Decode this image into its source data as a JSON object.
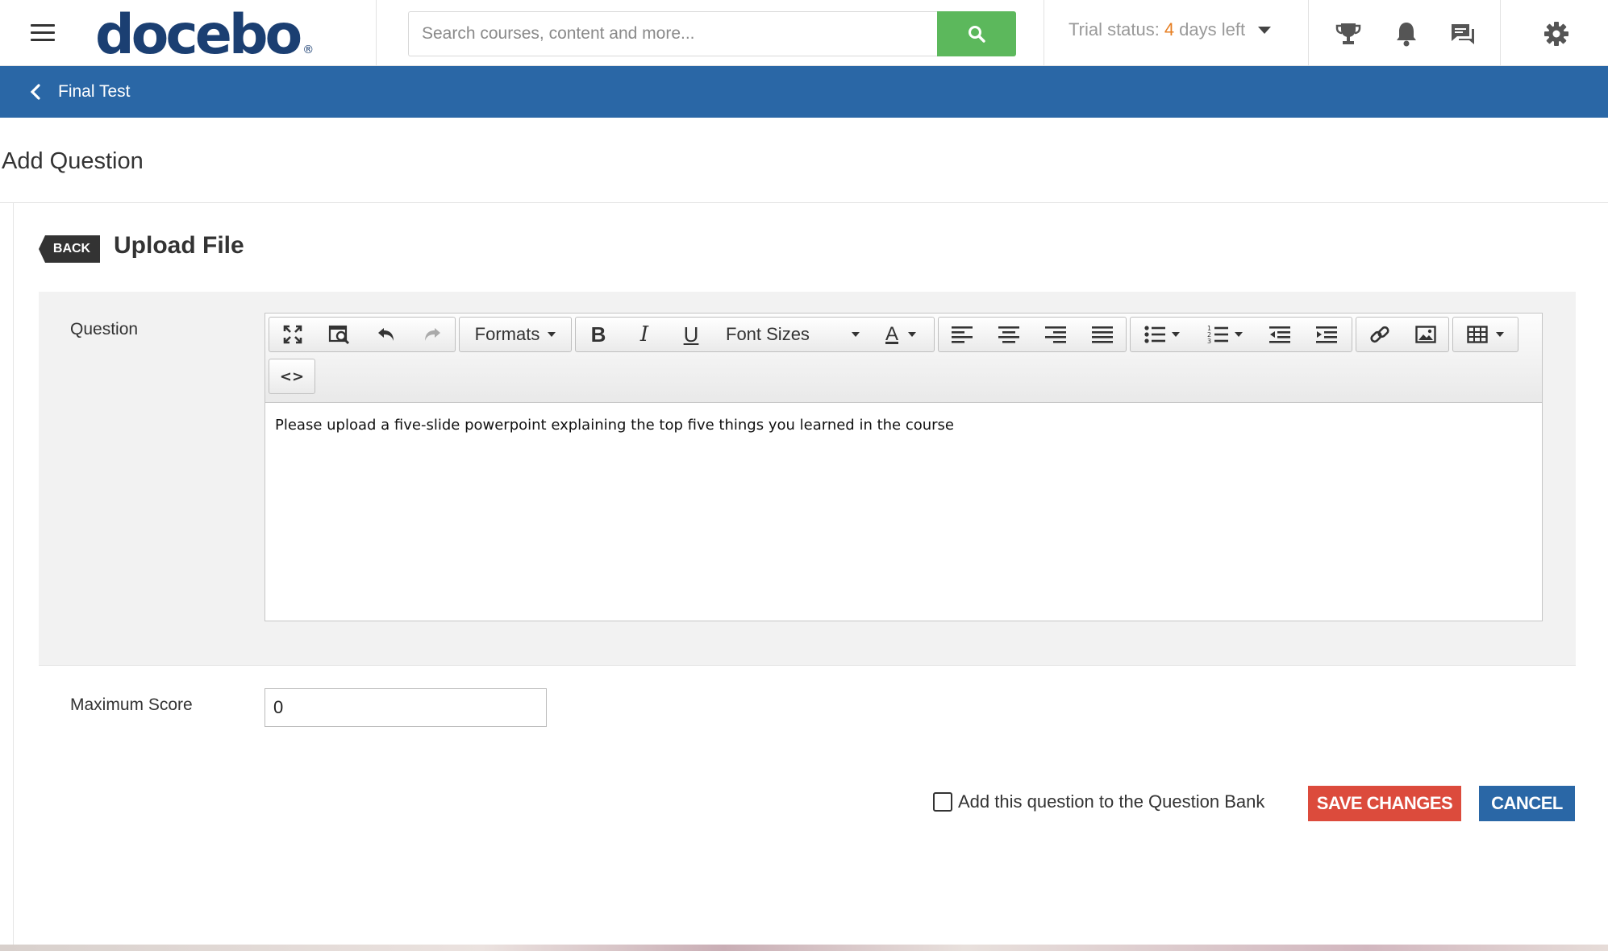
{
  "app": {
    "logo_text": "docebo",
    "logo_mark": "®"
  },
  "topbar": {
    "search_placeholder": "Search courses, content and more...",
    "trial_prefix": "Trial status:",
    "trial_days": "4",
    "trial_suffix": "days left",
    "icons": [
      "menu-icon",
      "search-icon",
      "trophy-icon",
      "bell-icon",
      "chat-icon",
      "gear-icon"
    ]
  },
  "breadcrumb": {
    "title": "Final Test"
  },
  "page": {
    "title": "Add Question"
  },
  "question": {
    "back_label": "BACK",
    "type_title": "Upload File",
    "question_label": "Question",
    "body_text": "Please upload a five-slide powerpoint explaining the top five things you learned in the course",
    "score_label": "Maximum Score",
    "score_value": "0"
  },
  "editor_toolbar": {
    "formats_label": "Formats",
    "font_sizes_label": "Font Sizes",
    "bold": "B",
    "italic": "I",
    "underline": "U",
    "font_color": "A",
    "code": "<>"
  },
  "footer": {
    "checkbox_label": "Add this question to the Question Bank",
    "checkbox_checked": false,
    "save_label": "SAVE CHANGES",
    "cancel_label": "CANCEL"
  },
  "colors": {
    "brand_blue": "#2a67a6",
    "logo_blue": "#1b3f72",
    "search_green": "#5cb85c",
    "trial_orange": "#e67e22",
    "save_red": "#dc4b3c"
  }
}
